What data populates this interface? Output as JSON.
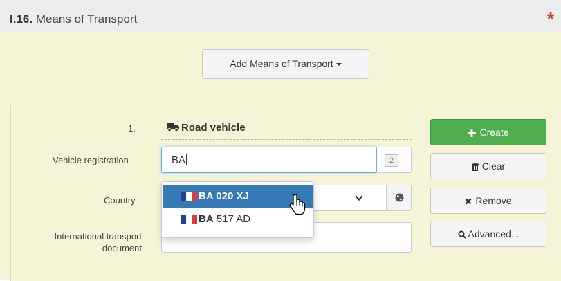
{
  "section": {
    "number": "I.16.",
    "title": "Means of Transport",
    "required_mark": "*"
  },
  "add_button": {
    "label": "Add Means of Transport"
  },
  "transport": {
    "index": "1.",
    "type_label": "Road vehicle",
    "vehicle_registration": {
      "label": "Vehicle registration",
      "value": "BA",
      "badge": "2"
    },
    "country": {
      "label": "Country"
    },
    "international_transport_document": {
      "label_line1": "International transport",
      "label_line2": "document",
      "value": ""
    }
  },
  "buttons": {
    "create": "Create",
    "clear": "Clear",
    "remove": "Remove",
    "advanced": "Advanced..."
  },
  "autocomplete": {
    "items": [
      {
        "bold": "BA 020 XJ",
        "rest": "",
        "country_flag": "FR",
        "highlighted": true
      },
      {
        "bold": "BA",
        "rest": " 517 AD",
        "country_flag": "FR",
        "highlighted": false
      }
    ]
  },
  "colors": {
    "accent": "#337ab7",
    "create": "#4cae4c",
    "required": "#d9342b",
    "panel": "#f6f4d6"
  }
}
